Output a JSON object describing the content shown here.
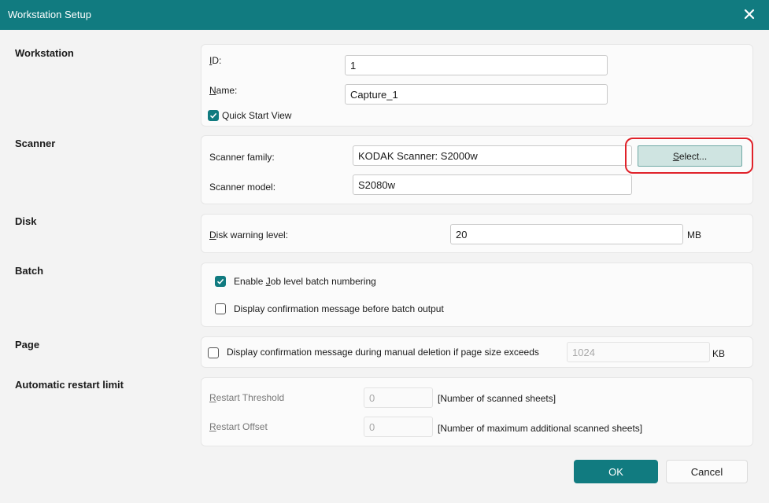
{
  "window": {
    "title": "Workstation Setup"
  },
  "sections": {
    "workstation": "Workstation",
    "scanner": "Scanner",
    "disk": "Disk",
    "batch": "Batch",
    "page": "Page",
    "restart": "Automatic restart limit"
  },
  "workstation": {
    "id_label_key": "I",
    "id_label_rest": "D:",
    "id_value": "1",
    "name_label_key": "N",
    "name_label_rest": "ame:",
    "name_value": "Capture_1",
    "quick_start_label": "Quick Start View",
    "quick_start_checked": true
  },
  "scanner": {
    "family_label": "Scanner family:",
    "family_value": "KODAK Scanner: S2000w",
    "select_key": "S",
    "select_rest": "elect...",
    "model_label": "Scanner model:",
    "model_value": "S2080w"
  },
  "disk": {
    "warning_label_key": "D",
    "warning_label_rest": "isk warning level:",
    "warning_value": "20",
    "unit": "MB"
  },
  "batch": {
    "job_numbering_pre": "Enable ",
    "job_numbering_key": "J",
    "job_numbering_rest": "ob level batch numbering",
    "job_numbering_checked": true,
    "confirm_label": "Display confirmation message before batch output",
    "confirm_checked": false
  },
  "page": {
    "confirm_label": "Display confirmation message during manual deletion if page size exceeds",
    "confirm_checked": false,
    "size_value": "1024",
    "unit": "KB"
  },
  "restart": {
    "threshold_key": "R",
    "threshold_rest": "estart Threshold",
    "threshold_value": "0",
    "threshold_desc": "[Number of scanned sheets]",
    "offset_key": "R",
    "offset_rest": "estart Offset",
    "offset_value": "0",
    "offset_desc": "[Number of maximum additional scanned sheets]"
  },
  "buttons": {
    "ok": "OK",
    "cancel": "Cancel"
  },
  "colors": {
    "accent": "#117b80",
    "highlight": "#e0222a",
    "select_bg": "#cfe4e1"
  }
}
